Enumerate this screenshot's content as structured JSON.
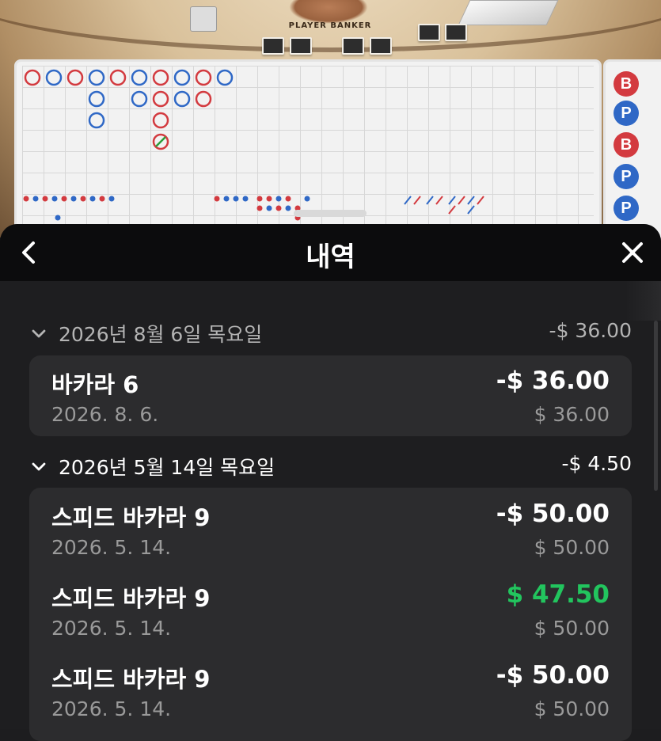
{
  "game": {
    "table_text": "PLAYER  BANKER",
    "bead_road": [
      "B",
      "P",
      "B",
      "P",
      "P"
    ],
    "colors": {
      "banker": "#d33a3f",
      "player": "#2f68c6"
    }
  },
  "sheet": {
    "title": "내역",
    "back_icon": "chevron-left-icon",
    "close_icon": "close-icon"
  },
  "history": [
    {
      "date": "2026년 8월 6일 목요일",
      "total": "-$ 36.00",
      "items": [
        {
          "name": "바카라 6",
          "date": "2026. 8. 6.",
          "amount": "-$ 36.00",
          "stake": "$ 36.00",
          "win": false
        }
      ]
    },
    {
      "date": "2026년 5월 14일 목요일",
      "total": "-$ 4.50",
      "items": [
        {
          "name": "스피드 바카라 9",
          "date": "2026. 5. 14.",
          "amount": "-$ 50.00",
          "stake": "$ 50.00",
          "win": false
        },
        {
          "name": "스피드 바카라 9",
          "date": "2026. 5. 14.",
          "amount": "$ 47.50",
          "stake": "$ 50.00",
          "win": true
        },
        {
          "name": "스피드 바카라 9",
          "date": "2026. 5. 14.",
          "amount": "-$ 50.00",
          "stake": "$ 50.00",
          "win": false
        }
      ]
    }
  ],
  "accent": {
    "win": "#22c55e",
    "text": "#ffffff",
    "muted": "#9a9a9a"
  }
}
